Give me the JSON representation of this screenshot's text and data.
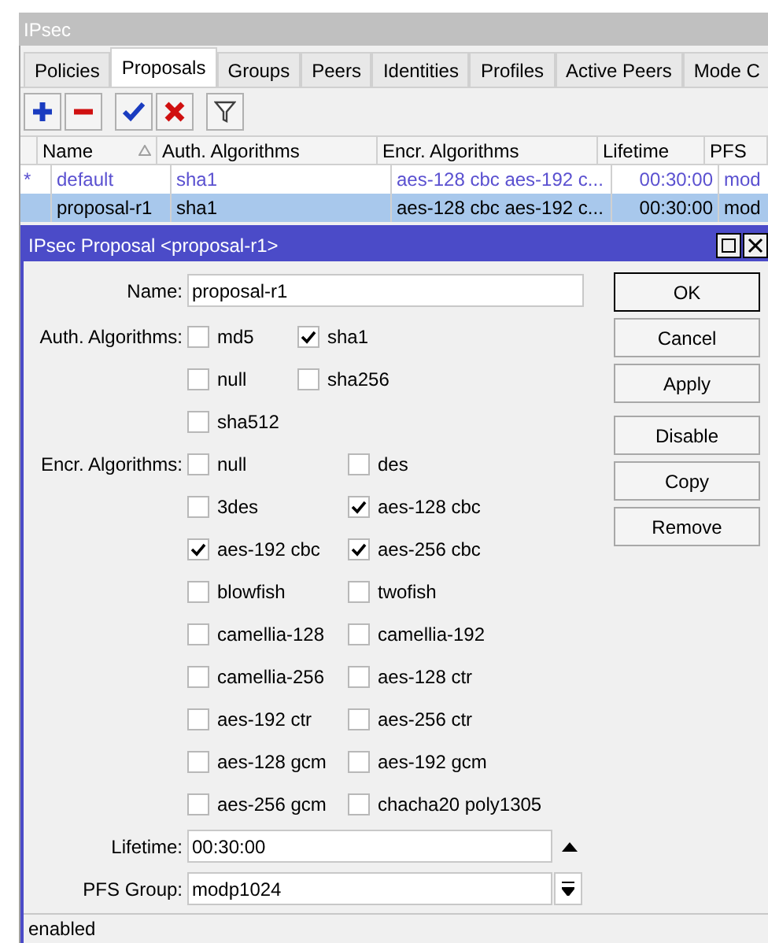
{
  "window": {
    "title": "IPsec"
  },
  "tabs": [
    {
      "label": "Policies",
      "selected": false
    },
    {
      "label": "Proposals",
      "selected": true
    },
    {
      "label": "Groups",
      "selected": false
    },
    {
      "label": "Peers",
      "selected": false
    },
    {
      "label": "Identities",
      "selected": false
    },
    {
      "label": "Profiles",
      "selected": false
    },
    {
      "label": "Active Peers",
      "selected": false
    },
    {
      "label": "Mode C",
      "selected": false
    }
  ],
  "table": {
    "columns": [
      "Name",
      "Auth. Algorithms",
      "Encr. Algorithms",
      "Lifetime",
      "PFS"
    ],
    "rows": [
      {
        "flag": "*",
        "kind": "default",
        "selected": false,
        "cells": [
          "default",
          "sha1",
          "aes-128 cbc aes-192 c...",
          "00:30:00",
          "mod"
        ]
      },
      {
        "flag": "",
        "kind": "static",
        "selected": true,
        "cells": [
          "proposal-r1",
          "sha1",
          "aes-128 cbc aes-192 c...",
          "00:30:00",
          "mod"
        ]
      }
    ]
  },
  "dialog": {
    "title": "IPsec Proposal <proposal-r1>",
    "name": {
      "label": "Name:",
      "value": "proposal-r1"
    },
    "auth": {
      "label": "Auth. Algorithms:",
      "options": [
        {
          "label": "md5",
          "checked": false
        },
        {
          "label": "sha1",
          "checked": true
        },
        {
          "label": "null",
          "checked": false
        },
        {
          "label": "sha256",
          "checked": false
        },
        {
          "label": "sha512",
          "checked": false
        }
      ]
    },
    "encr": {
      "label": "Encr. Algorithms:",
      "options": [
        {
          "label": "null",
          "checked": false
        },
        {
          "label": "des",
          "checked": false
        },
        {
          "label": "3des",
          "checked": false
        },
        {
          "label": "aes-128 cbc",
          "checked": true
        },
        {
          "label": "aes-192 cbc",
          "checked": true
        },
        {
          "label": "aes-256 cbc",
          "checked": true
        },
        {
          "label": "blowfish",
          "checked": false
        },
        {
          "label": "twofish",
          "checked": false
        },
        {
          "label": "camellia-128",
          "checked": false
        },
        {
          "label": "camellia-192",
          "checked": false
        },
        {
          "label": "camellia-256",
          "checked": false
        },
        {
          "label": "aes-128 ctr",
          "checked": false
        },
        {
          "label": "aes-192 ctr",
          "checked": false
        },
        {
          "label": "aes-256 ctr",
          "checked": false
        },
        {
          "label": "aes-128 gcm",
          "checked": false
        },
        {
          "label": "aes-192 gcm",
          "checked": false
        },
        {
          "label": "aes-256 gcm",
          "checked": false
        },
        {
          "label": "chacha20 poly1305",
          "checked": false
        }
      ]
    },
    "lifetime": {
      "label": "Lifetime:",
      "value": "00:30:00"
    },
    "pfs_group": {
      "label": "PFS Group:",
      "value": "modp1024"
    },
    "buttons": [
      "OK",
      "Cancel",
      "Apply",
      "Disable",
      "Copy",
      "Remove"
    ],
    "status": "enabled"
  }
}
